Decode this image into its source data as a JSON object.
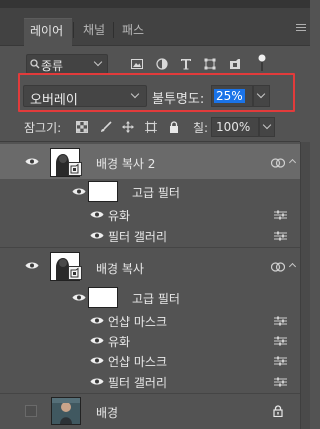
{
  "tabs": [
    {
      "label": "레이어",
      "active": true
    },
    {
      "label": "채널",
      "active": false
    },
    {
      "label": "패스",
      "active": false
    }
  ],
  "filter": {
    "kind_label": "종류",
    "icons": [
      "image-filter-icon",
      "adjustment-filter-icon",
      "type-filter-icon",
      "shape-filter-icon",
      "smart-object-filter-icon",
      "filter-toggle-icon"
    ]
  },
  "blend": {
    "mode": "오버레이",
    "opacity_label": "불투명도:",
    "opacity_value": "25%"
  },
  "lock": {
    "label": "잠그기:",
    "fill_label": "칠:",
    "fill_value": "100%"
  },
  "layers": [
    {
      "name": "배경 복사 2",
      "selected": true
    },
    {
      "name": "고급 필터"
    },
    {
      "name": "유화"
    },
    {
      "name": "필터 갤러리"
    },
    {
      "name": "배경 복사"
    },
    {
      "name": "고급 필터"
    },
    {
      "name": "언샵 마스크"
    },
    {
      "name": "유화"
    },
    {
      "name": "언샵 마스크"
    },
    {
      "name": "필터 갤러리"
    },
    {
      "name": "배경"
    }
  ],
  "colors": {
    "panel": "#535353",
    "selected_row": "#6a6a6a",
    "highlight": "#e23b3b",
    "selection_blue": "#1a73e8"
  }
}
